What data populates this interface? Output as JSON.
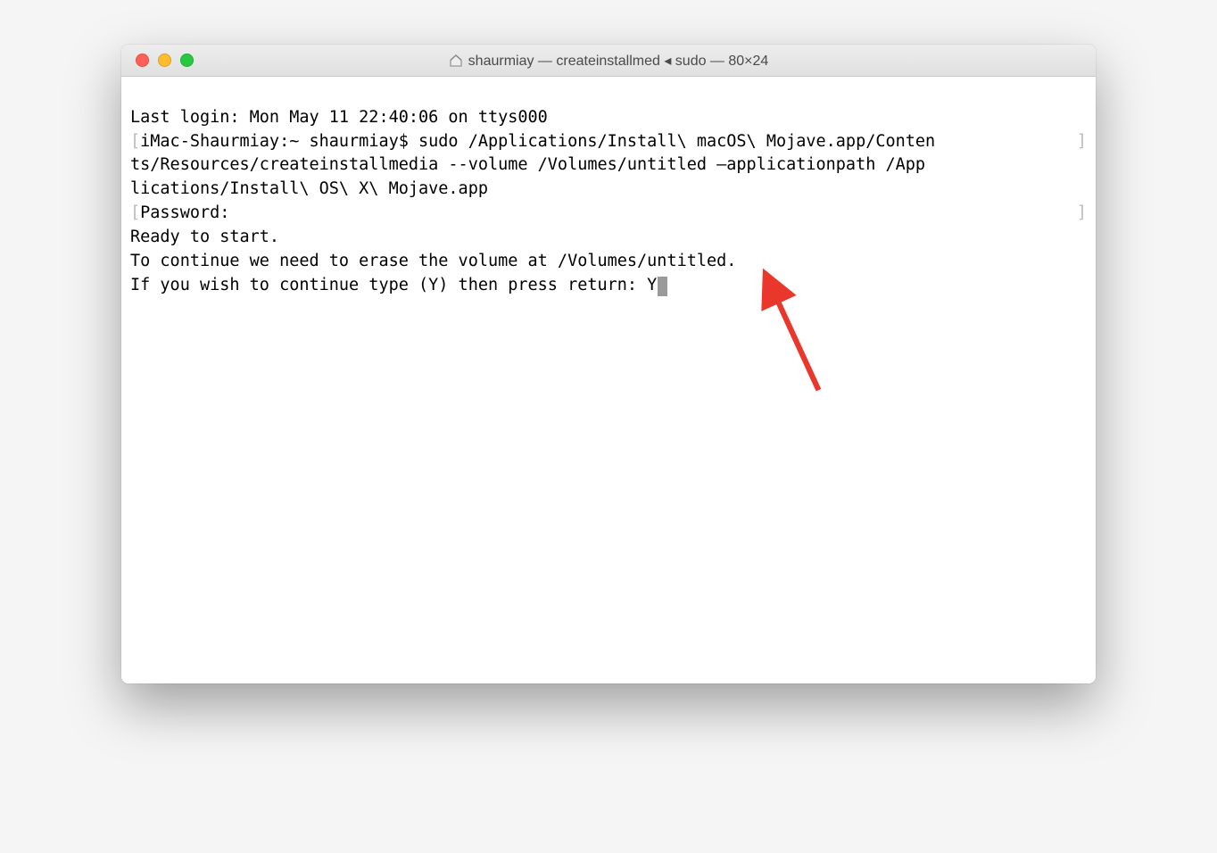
{
  "window": {
    "title": "shaurmiay — createinstallmed ◂ sudo — 80×24"
  },
  "terminal": {
    "line1": "Last login: Mon May 11 22:40:06 on ttys000",
    "line2_prefix": "[",
    "line2_text": "iMac-Shaurmiay:~ shaurmiay$ sudo /Applications/Install\\ macOS\\ Mojave.app/Conten",
    "line2_suffix": "]",
    "line3": "ts/Resources/createinstallmedia --volume /Volumes/untitled —applicationpath /App",
    "line4": "lications/Install\\ OS\\ X\\ Mojave.app",
    "line5_prefix": "[",
    "line5_text": "Password:",
    "line5_suffix": "]",
    "line6": "Ready to start.",
    "line7": "To continue we need to erase the volume at /Volumes/untitled.",
    "line8": "If you wish to continue type (Y) then press return: Y"
  },
  "annotation": {
    "arrow_color": "#e9382b"
  }
}
